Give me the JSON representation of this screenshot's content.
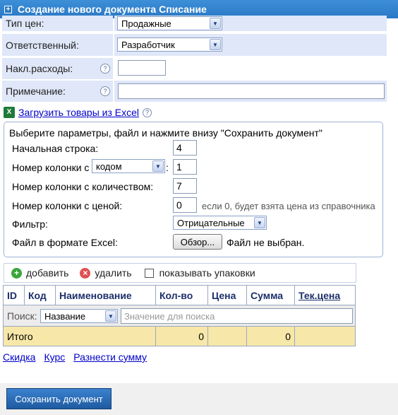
{
  "title": "Создание нового документа Списание",
  "form": {
    "price_type_label": "Тип цен:",
    "price_type_value": "Продажные",
    "responsible_label": "Ответственный:",
    "responsible_value": "Разработчик",
    "overhead_label": "Накл.расходы:",
    "overhead_value": "",
    "note_label": "Примечание:",
    "note_value": "",
    "help_symbol": "?"
  },
  "excel_import": {
    "link_label": "Загрузить товары из Excel",
    "icon_text": "X",
    "instruction": "Выберите параметры, файл и нажмите внизу \"Сохранить документ\"",
    "start_row_label": "Начальная строка:",
    "start_row_value": "4",
    "code_col_label": "Номер колонки с",
    "code_col_select": "кодом",
    "code_col_colon": ":",
    "code_col_value": "1",
    "qty_col_label": "Номер колонки с количеством:",
    "qty_col_value": "7",
    "price_col_label": "Номер колонки с ценой:",
    "price_col_value": "0",
    "price_col_hint": "если 0, будет взята цена из справочника",
    "filter_label": "Фильтр:",
    "filter_value": "Отрицательные",
    "file_label": "Файл в формате Excel:",
    "browse_label": "Обзор...",
    "file_status": "Файл не выбран."
  },
  "toolbar": {
    "add_label": "добавить",
    "delete_label": "удалить",
    "packages_label": "показывать упаковки"
  },
  "table": {
    "columns": [
      "ID",
      "Код",
      "Наименование",
      "Кол-во",
      "Цена",
      "Сумма",
      "Тек.цена"
    ],
    "search_label": "Поиск:",
    "search_field": "Название",
    "search_placeholder": "Значение для поиска",
    "total_label": "Итого",
    "total_qty": "0",
    "total_sum": "0"
  },
  "links": {
    "discount": "Скидка",
    "rate": "Курс",
    "distribute": "Разнести сумму"
  },
  "footer": {
    "save_label": "Сохранить документ"
  },
  "colors": {
    "title_bar": "#2a78c4",
    "form_bg": "#dfe7f8",
    "total_row": "#f7e7a8",
    "save_button": "#1e5aa0"
  }
}
